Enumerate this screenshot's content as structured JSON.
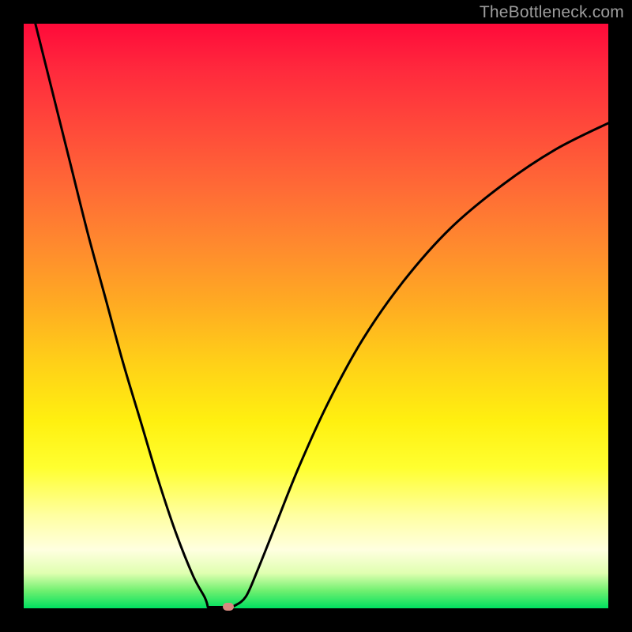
{
  "watermark": "TheBottleneck.com",
  "colors": {
    "curve": "#000000",
    "marker": "#d88a80",
    "frame": "#000000"
  },
  "chart_data": {
    "type": "line",
    "title": "",
    "xlabel": "",
    "ylabel": "",
    "xlim": [
      0,
      100
    ],
    "ylim": [
      0,
      100
    ],
    "grid": false,
    "legend": false,
    "series": [
      {
        "name": "bottleneck-curve",
        "x": [
          2,
          5,
          8,
          11,
          14,
          17,
          20,
          23,
          26,
          29,
          31,
          33,
          34.5,
          36,
          38,
          40,
          43,
          47,
          52,
          58,
          65,
          73,
          82,
          91,
          100
        ],
        "y": [
          100,
          88,
          76,
          64,
          53,
          42,
          32,
          22,
          13,
          5.5,
          1.8,
          0.5,
          0.2,
          0.4,
          2,
          6.5,
          14,
          24,
          35,
          46,
          56,
          65,
          72.5,
          78.5,
          83
        ]
      }
    ],
    "marker": {
      "x": 35,
      "y": 0.3
    },
    "flat_segment": {
      "x_start": 31.5,
      "x_end": 35,
      "y": 0.2
    }
  }
}
